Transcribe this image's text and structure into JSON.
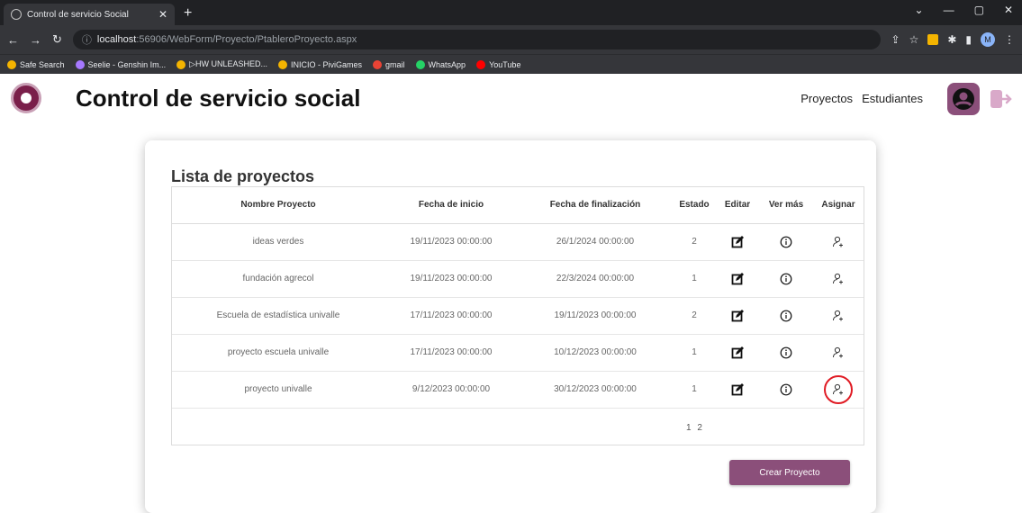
{
  "browser": {
    "tab_title": "Control de servicio Social",
    "url_host": "localhost",
    "url_rest": ":56906/WebForm/Proyecto/PtableroProyecto.aspx",
    "profile_initial": "M",
    "bookmarks": [
      {
        "label": "Safe Search",
        "color": "#f4b400"
      },
      {
        "label": "Seelie - Genshin Im...",
        "color": "#a678ff"
      },
      {
        "label": "▷HW UNLEASHED...",
        "color": "#f4b400"
      },
      {
        "label": "INICIO - PiviGames",
        "color": "#f4b400"
      },
      {
        "label": "gmail",
        "color": "#ea4335"
      },
      {
        "label": "WhatsApp",
        "color": "#25d366"
      },
      {
        "label": "YouTube",
        "color": "#ff0000"
      }
    ]
  },
  "header": {
    "title": "Control de servicio social",
    "nav_proyectos": "Proyectos",
    "nav_estudiantes": "Estudiantes"
  },
  "main": {
    "list_title": "Lista de proyectos",
    "columns": [
      "Nombre Proyecto",
      "Fecha de inicio",
      "Fecha de finalización",
      "Estado",
      "Editar",
      "Ver más",
      "Asignar"
    ],
    "rows": [
      {
        "name": "ideas verdes",
        "start": "19/11/2023 00:00:00",
        "end": "26/1/2024 00:00:00",
        "estado": "2"
      },
      {
        "name": "fundación agrecol",
        "start": "19/11/2023 00:00:00",
        "end": "22/3/2024 00:00:00",
        "estado": "1"
      },
      {
        "name": "Escuela de estadística univalle",
        "start": "17/11/2023 00:00:00",
        "end": "19/11/2023 00:00:00",
        "estado": "2"
      },
      {
        "name": "proyecto escuela univalle",
        "start": "17/11/2023 00:00:00",
        "end": "10/12/2023 00:00:00",
        "estado": "1"
      },
      {
        "name": "proyecto univalle",
        "start": "9/12/2023 00:00:00",
        "end": "30/12/2023 00:00:00",
        "estado": "1"
      }
    ],
    "pages": [
      "1",
      "2"
    ],
    "create_button": "Crear Proyecto"
  },
  "colors": {
    "brand": "#8b4f7a",
    "highlight": "#e01b24"
  }
}
